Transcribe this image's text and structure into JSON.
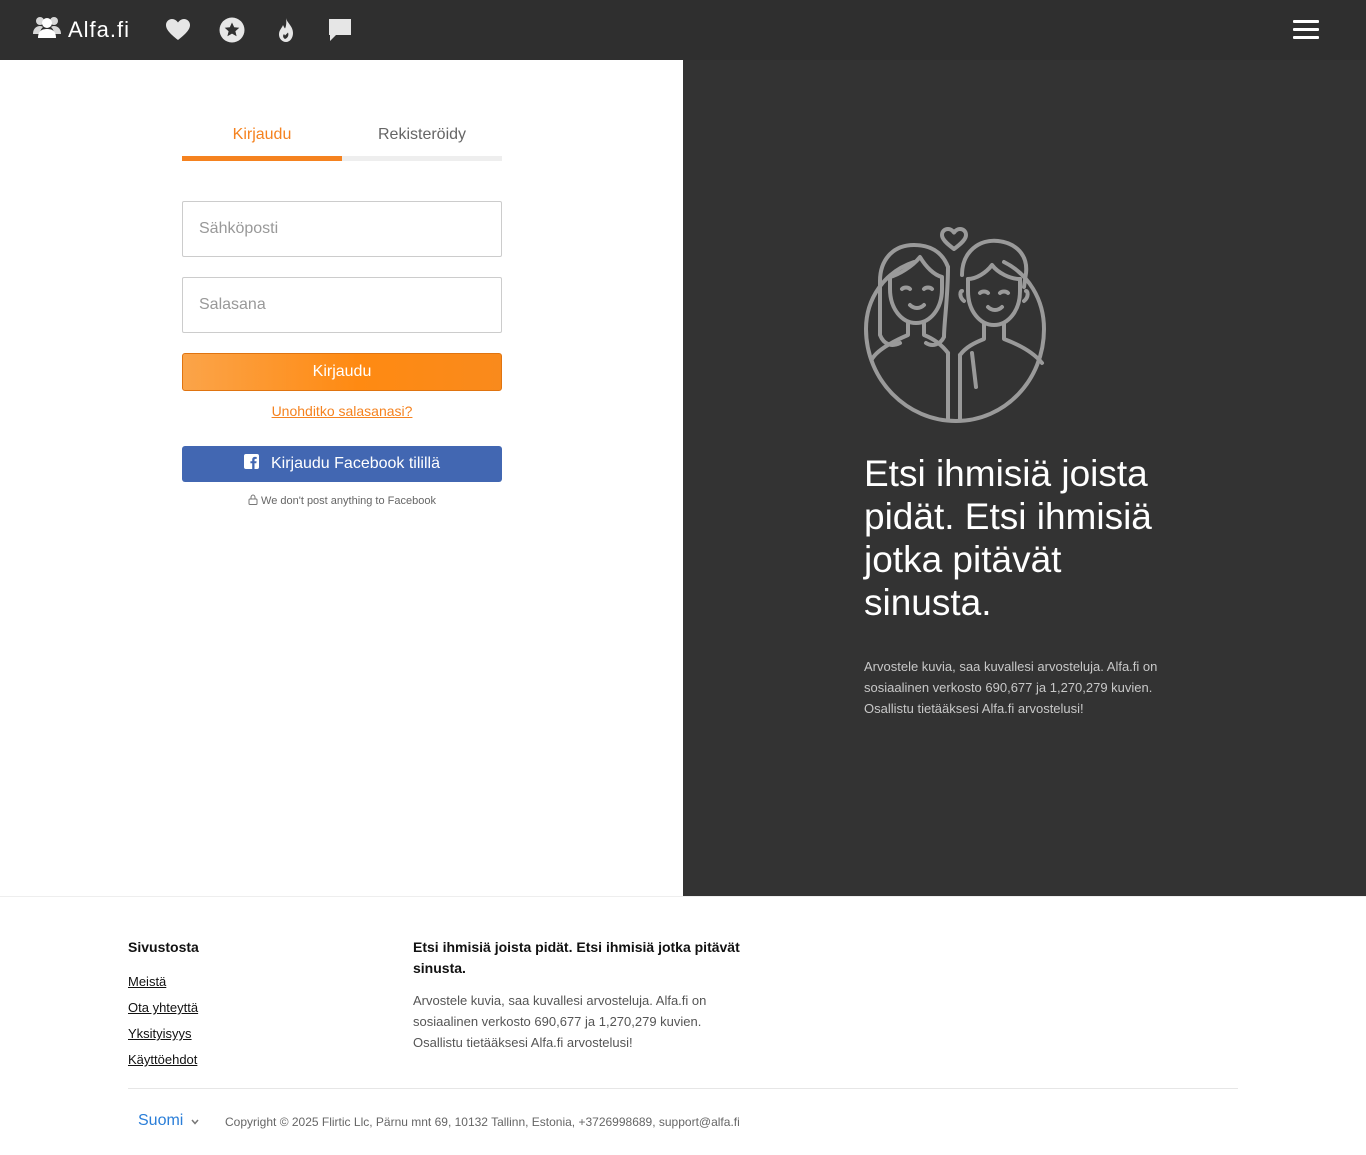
{
  "header": {
    "brand": "Alfa.fi",
    "nav_icons": [
      "users-icon",
      "heart-icon",
      "star-icon",
      "flame-icon",
      "chat-icon",
      "menu-icon"
    ],
    "bg_color": "#2f2f2f"
  },
  "auth": {
    "tabs": [
      {
        "label": "Kirjaudu",
        "active": true
      },
      {
        "label": "Rekisteröidy",
        "active": false
      }
    ],
    "email_placeholder": "Sähköposti",
    "password_placeholder": "Salasana",
    "login_label": "Kirjaudu",
    "forgot_label": "Unohditko salasanasi?",
    "facebook_label": "Kirjaudu Facebook tilillä",
    "facebook_note": "We don't post anything to Facebook",
    "accent_color": "#f5821f",
    "facebook_color": "#4267b2"
  },
  "hero": {
    "title": "Etsi ihmisiä joista pidät. Etsi ihmisiä jotka pitävät sinusta.",
    "text": "Arvostele kuvia, saa kuvallesi arvosteluja. Alfa.fi on sosiaalinen verkosto 690,677 ja 1,270,279 kuvien. Osallistu tietääksesi Alfa.fi arvostelusi!",
    "bg_color": "#333333"
  },
  "footer": {
    "heading": "Sivustosta",
    "links": [
      "Meistä",
      "Ota yhteyttä",
      "Yksityisyys",
      "Käyttöehdot"
    ],
    "about_title": "Etsi ihmisiä joista pidät. Etsi ihmisiä jotka pitävät sinusta.",
    "about_text": "Arvostele kuvia, saa kuvallesi arvosteluja. Alfa.fi on sosiaalinen verkosto 690,677 ja 1,270,279 kuvien. Osallistu tietääksesi Alfa.fi arvostelusi!",
    "language": "Suomi",
    "copyright": "Copyright © 2025 Flirtic Llc, Pärnu mnt 69, 10132 Tallinn, Estonia, +3726998689, support@alfa.fi"
  }
}
